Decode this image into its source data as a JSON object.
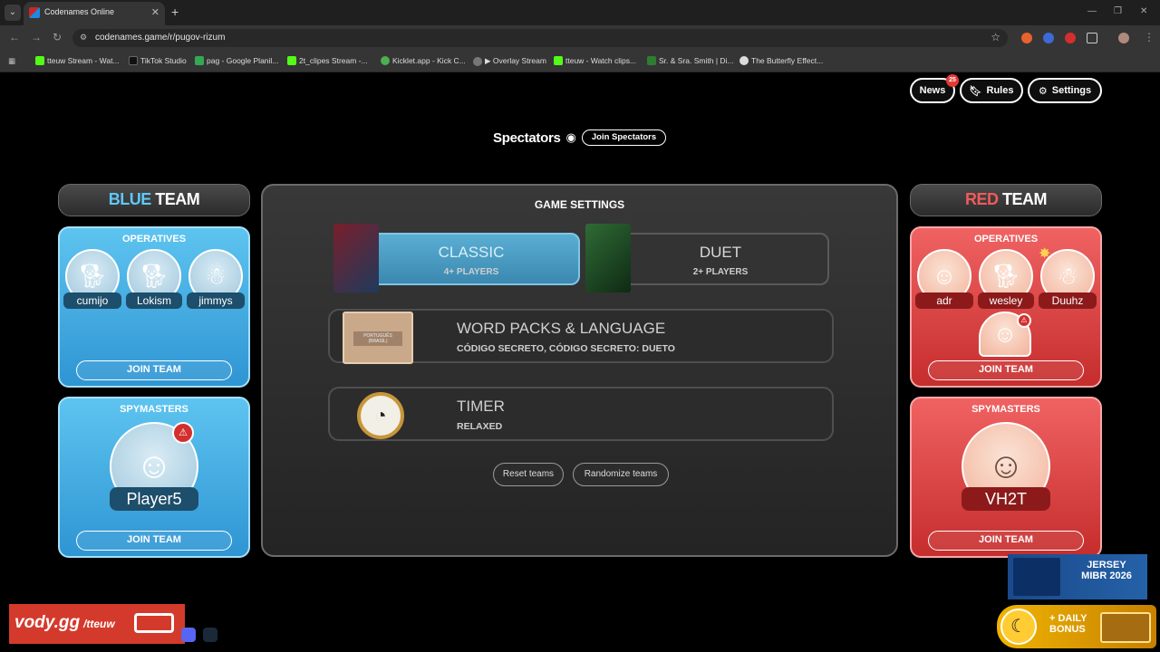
{
  "browser": {
    "tab_title": "Codenames Online",
    "new_tab": "+",
    "url": "codenames.game/r/pugov-rizum",
    "bookmarks": [
      {
        "label": "tteuw Stream - Wat...",
        "color": "#53fc18"
      },
      {
        "label": "TikTok Studio",
        "color": "#000000"
      },
      {
        "label": "pag - Google Planil...",
        "color": "#34a853"
      },
      {
        "label": "2t_clipes Stream -...",
        "color": "#53fc18"
      },
      {
        "label": "Kicklet.app - Kick C...",
        "color": "#4caf50"
      },
      {
        "label": "▶ Overlay Stream",
        "color": "#888888"
      },
      {
        "label": "tteuw - Watch clips...",
        "color": "#53fc18"
      },
      {
        "label": "Sr. & Sra. Smith | Di...",
        "color": "#2e7d32"
      },
      {
        "label": "The Butterfly Effect...",
        "color": "#dddddd"
      }
    ]
  },
  "header": {
    "news_label": "News",
    "news_count": "25",
    "rules_label": "Rules",
    "settings_label": "Settings"
  },
  "spectators": {
    "title": "Spectators",
    "join_label": "Join Spectators"
  },
  "blue_team": {
    "title_color_word": "BLUE",
    "title_word": "TEAM",
    "accent": "#5ec8f5",
    "operatives_label": "OPERATIVES",
    "operatives": [
      "cumijo",
      "Lokism",
      "jimmys"
    ],
    "join_label": "JOIN TEAM",
    "spymasters_label": "SPYMASTERS",
    "spymaster": "Player5",
    "spy_join_label": "JOIN TEAM"
  },
  "red_team": {
    "title_color_word": "RED",
    "title_word": "TEAM",
    "accent": "#f05a5a",
    "operatives_label": "OPERATIVES",
    "operatives": [
      "adr",
      "wesley",
      "Duuhz"
    ],
    "join_label": "JOIN TEAM",
    "spymasters_label": "SPYMASTERS",
    "spymaster": "VH2T",
    "spy_join_label": "JOIN TEAM"
  },
  "game_settings": {
    "title": "GAME SETTINGS",
    "modes": [
      {
        "name": "CLASSIC",
        "sub": "4+ PLAYERS",
        "active": true
      },
      {
        "name": "DUET",
        "sub": "2+ PLAYERS",
        "active": false
      }
    ],
    "word_packs": {
      "title": "WORD PACKS & LANGUAGE",
      "value": "CÓDIGO SECRETO, CÓDIGO SECRETO: DUETO",
      "box_label": "PORTUGUÊS (BRASIL)"
    },
    "timer": {
      "title": "TIMER",
      "value": "RELAXED"
    },
    "reset_label": "Reset teams",
    "randomize_label": "Randomize teams"
  },
  "overlay": {
    "vody": "vody.gg",
    "vody_user": "/tteuw",
    "promo": "JERSEY MIBR 2026",
    "bonus": "+ DAILY BONUS"
  }
}
